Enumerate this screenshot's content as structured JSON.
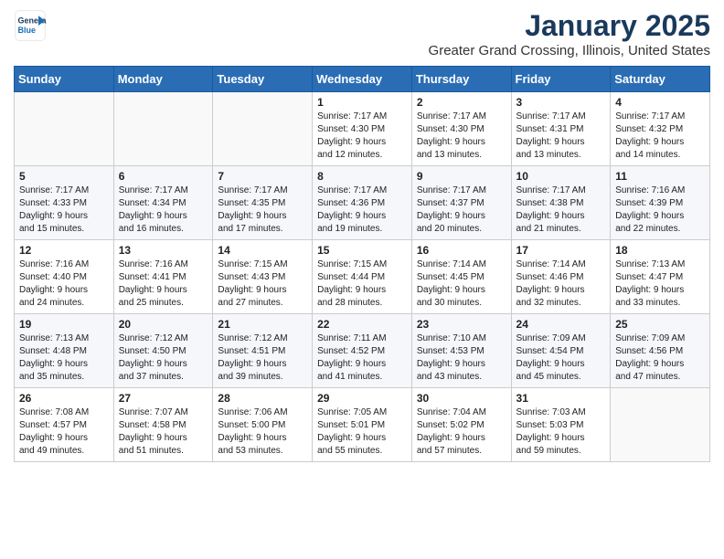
{
  "header": {
    "logo_line1": "General",
    "logo_line2": "Blue",
    "month": "January 2025",
    "location": "Greater Grand Crossing, Illinois, United States"
  },
  "weekdays": [
    "Sunday",
    "Monday",
    "Tuesday",
    "Wednesday",
    "Thursday",
    "Friday",
    "Saturday"
  ],
  "weeks": [
    [
      {
        "day": "",
        "info": ""
      },
      {
        "day": "",
        "info": ""
      },
      {
        "day": "",
        "info": ""
      },
      {
        "day": "1",
        "info": "Sunrise: 7:17 AM\nSunset: 4:30 PM\nDaylight: 9 hours\nand 12 minutes."
      },
      {
        "day": "2",
        "info": "Sunrise: 7:17 AM\nSunset: 4:30 PM\nDaylight: 9 hours\nand 13 minutes."
      },
      {
        "day": "3",
        "info": "Sunrise: 7:17 AM\nSunset: 4:31 PM\nDaylight: 9 hours\nand 13 minutes."
      },
      {
        "day": "4",
        "info": "Sunrise: 7:17 AM\nSunset: 4:32 PM\nDaylight: 9 hours\nand 14 minutes."
      }
    ],
    [
      {
        "day": "5",
        "info": "Sunrise: 7:17 AM\nSunset: 4:33 PM\nDaylight: 9 hours\nand 15 minutes."
      },
      {
        "day": "6",
        "info": "Sunrise: 7:17 AM\nSunset: 4:34 PM\nDaylight: 9 hours\nand 16 minutes."
      },
      {
        "day": "7",
        "info": "Sunrise: 7:17 AM\nSunset: 4:35 PM\nDaylight: 9 hours\nand 17 minutes."
      },
      {
        "day": "8",
        "info": "Sunrise: 7:17 AM\nSunset: 4:36 PM\nDaylight: 9 hours\nand 19 minutes."
      },
      {
        "day": "9",
        "info": "Sunrise: 7:17 AM\nSunset: 4:37 PM\nDaylight: 9 hours\nand 20 minutes."
      },
      {
        "day": "10",
        "info": "Sunrise: 7:17 AM\nSunset: 4:38 PM\nDaylight: 9 hours\nand 21 minutes."
      },
      {
        "day": "11",
        "info": "Sunrise: 7:16 AM\nSunset: 4:39 PM\nDaylight: 9 hours\nand 22 minutes."
      }
    ],
    [
      {
        "day": "12",
        "info": "Sunrise: 7:16 AM\nSunset: 4:40 PM\nDaylight: 9 hours\nand 24 minutes."
      },
      {
        "day": "13",
        "info": "Sunrise: 7:16 AM\nSunset: 4:41 PM\nDaylight: 9 hours\nand 25 minutes."
      },
      {
        "day": "14",
        "info": "Sunrise: 7:15 AM\nSunset: 4:43 PM\nDaylight: 9 hours\nand 27 minutes."
      },
      {
        "day": "15",
        "info": "Sunrise: 7:15 AM\nSunset: 4:44 PM\nDaylight: 9 hours\nand 28 minutes."
      },
      {
        "day": "16",
        "info": "Sunrise: 7:14 AM\nSunset: 4:45 PM\nDaylight: 9 hours\nand 30 minutes."
      },
      {
        "day": "17",
        "info": "Sunrise: 7:14 AM\nSunset: 4:46 PM\nDaylight: 9 hours\nand 32 minutes."
      },
      {
        "day": "18",
        "info": "Sunrise: 7:13 AM\nSunset: 4:47 PM\nDaylight: 9 hours\nand 33 minutes."
      }
    ],
    [
      {
        "day": "19",
        "info": "Sunrise: 7:13 AM\nSunset: 4:48 PM\nDaylight: 9 hours\nand 35 minutes."
      },
      {
        "day": "20",
        "info": "Sunrise: 7:12 AM\nSunset: 4:50 PM\nDaylight: 9 hours\nand 37 minutes."
      },
      {
        "day": "21",
        "info": "Sunrise: 7:12 AM\nSunset: 4:51 PM\nDaylight: 9 hours\nand 39 minutes."
      },
      {
        "day": "22",
        "info": "Sunrise: 7:11 AM\nSunset: 4:52 PM\nDaylight: 9 hours\nand 41 minutes."
      },
      {
        "day": "23",
        "info": "Sunrise: 7:10 AM\nSunset: 4:53 PM\nDaylight: 9 hours\nand 43 minutes."
      },
      {
        "day": "24",
        "info": "Sunrise: 7:09 AM\nSunset: 4:54 PM\nDaylight: 9 hours\nand 45 minutes."
      },
      {
        "day": "25",
        "info": "Sunrise: 7:09 AM\nSunset: 4:56 PM\nDaylight: 9 hours\nand 47 minutes."
      }
    ],
    [
      {
        "day": "26",
        "info": "Sunrise: 7:08 AM\nSunset: 4:57 PM\nDaylight: 9 hours\nand 49 minutes."
      },
      {
        "day": "27",
        "info": "Sunrise: 7:07 AM\nSunset: 4:58 PM\nDaylight: 9 hours\nand 51 minutes."
      },
      {
        "day": "28",
        "info": "Sunrise: 7:06 AM\nSunset: 5:00 PM\nDaylight: 9 hours\nand 53 minutes."
      },
      {
        "day": "29",
        "info": "Sunrise: 7:05 AM\nSunset: 5:01 PM\nDaylight: 9 hours\nand 55 minutes."
      },
      {
        "day": "30",
        "info": "Sunrise: 7:04 AM\nSunset: 5:02 PM\nDaylight: 9 hours\nand 57 minutes."
      },
      {
        "day": "31",
        "info": "Sunrise: 7:03 AM\nSunset: 5:03 PM\nDaylight: 9 hours\nand 59 minutes."
      },
      {
        "day": "",
        "info": ""
      }
    ]
  ]
}
